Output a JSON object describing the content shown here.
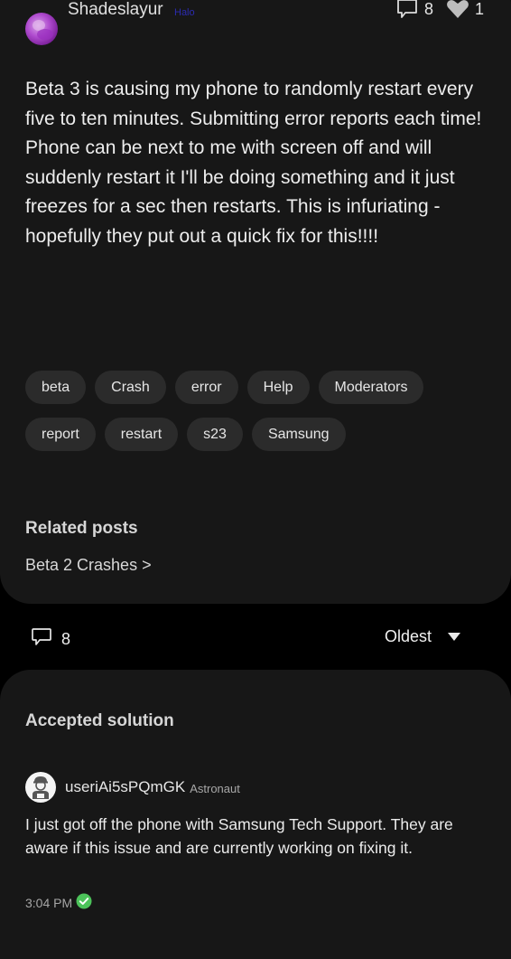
{
  "post": {
    "author": {
      "name": "Shadeslayur",
      "rank": "Halo",
      "avatar_icon": "user-avatar-photo"
    },
    "stats": {
      "reply_icon": "comment-icon",
      "reply_count": "8",
      "like_icon": "heart-icon",
      "like_count": "1"
    },
    "body": "Beta 3 is causing my phone to randomly restart every five to ten minutes. Submitting error reports each time! Phone can be next to me with screen off and will suddenly restart it I'll be doing something and it just freezes for a sec then restarts. This is infuriating - hopefully they put out a quick fix for this!!!!",
    "tags": [
      "beta",
      "Crash",
      "error",
      "Help",
      "Moderators",
      "report",
      "restart",
      "s23",
      "Samsung"
    ]
  },
  "related": {
    "title": "Related posts",
    "links": [
      {
        "label": "Beta 2 Crashes >"
      }
    ]
  },
  "comments_bar": {
    "icon": "comment-icon",
    "count": "8",
    "sort_label": "Oldest",
    "sort_icon": "caret-down-icon"
  },
  "accepted_solution": {
    "title": "Accepted solution",
    "author": {
      "name": "useriAi5sPQmGK",
      "rank": "Astronaut",
      "avatar_icon": "default-user-avatar"
    },
    "body": "I just got off the phone with Samsung Tech Support. They are aware if this issue and are currently working on fixing it.",
    "time": "3:04 PM",
    "status_icon": "accepted-check-icon"
  },
  "colors": {
    "background": "#000000",
    "card": "#171717",
    "tag_bg": "#2b2b2b",
    "rank_halo": "#2b2bb0",
    "accepted_green": "#4cc35a"
  }
}
